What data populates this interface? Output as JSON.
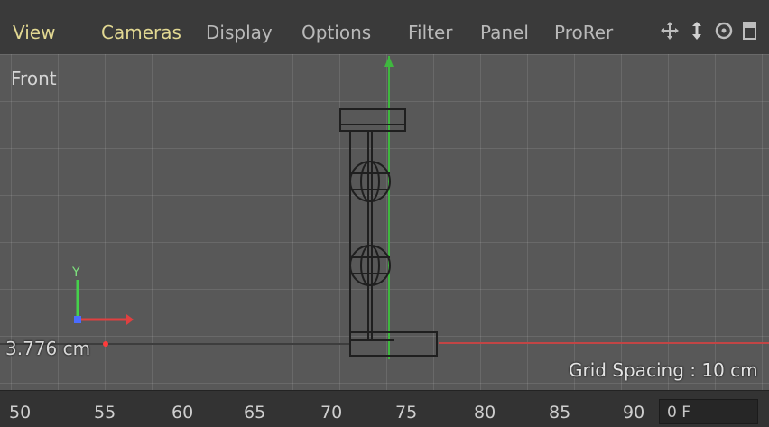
{
  "menu": {
    "items": [
      "View",
      "Cameras",
      "Display",
      "Options",
      "Filter",
      "Panel",
      "ProRer"
    ]
  },
  "toolbar": {
    "icons": [
      "move-view-icon",
      "dolly-view-icon",
      "rotate-view-icon",
      "toggle-view-icon"
    ]
  },
  "viewport": {
    "view_name": "Front",
    "coordinate_readout": "3.776 cm",
    "grid_spacing": "Grid Spacing : 10 cm",
    "axes": {
      "y_label": "Y"
    }
  },
  "timeline": {
    "ticks": [
      "50",
      "55",
      "60",
      "65",
      "70",
      "75",
      "80",
      "85",
      "90"
    ],
    "frame_field": "0 F"
  },
  "colors": {
    "menu_active": "#e9e08a",
    "y_axis": "#40d24b",
    "x_axis": "#ff3333",
    "wireframe": "#1f1f1f"
  }
}
